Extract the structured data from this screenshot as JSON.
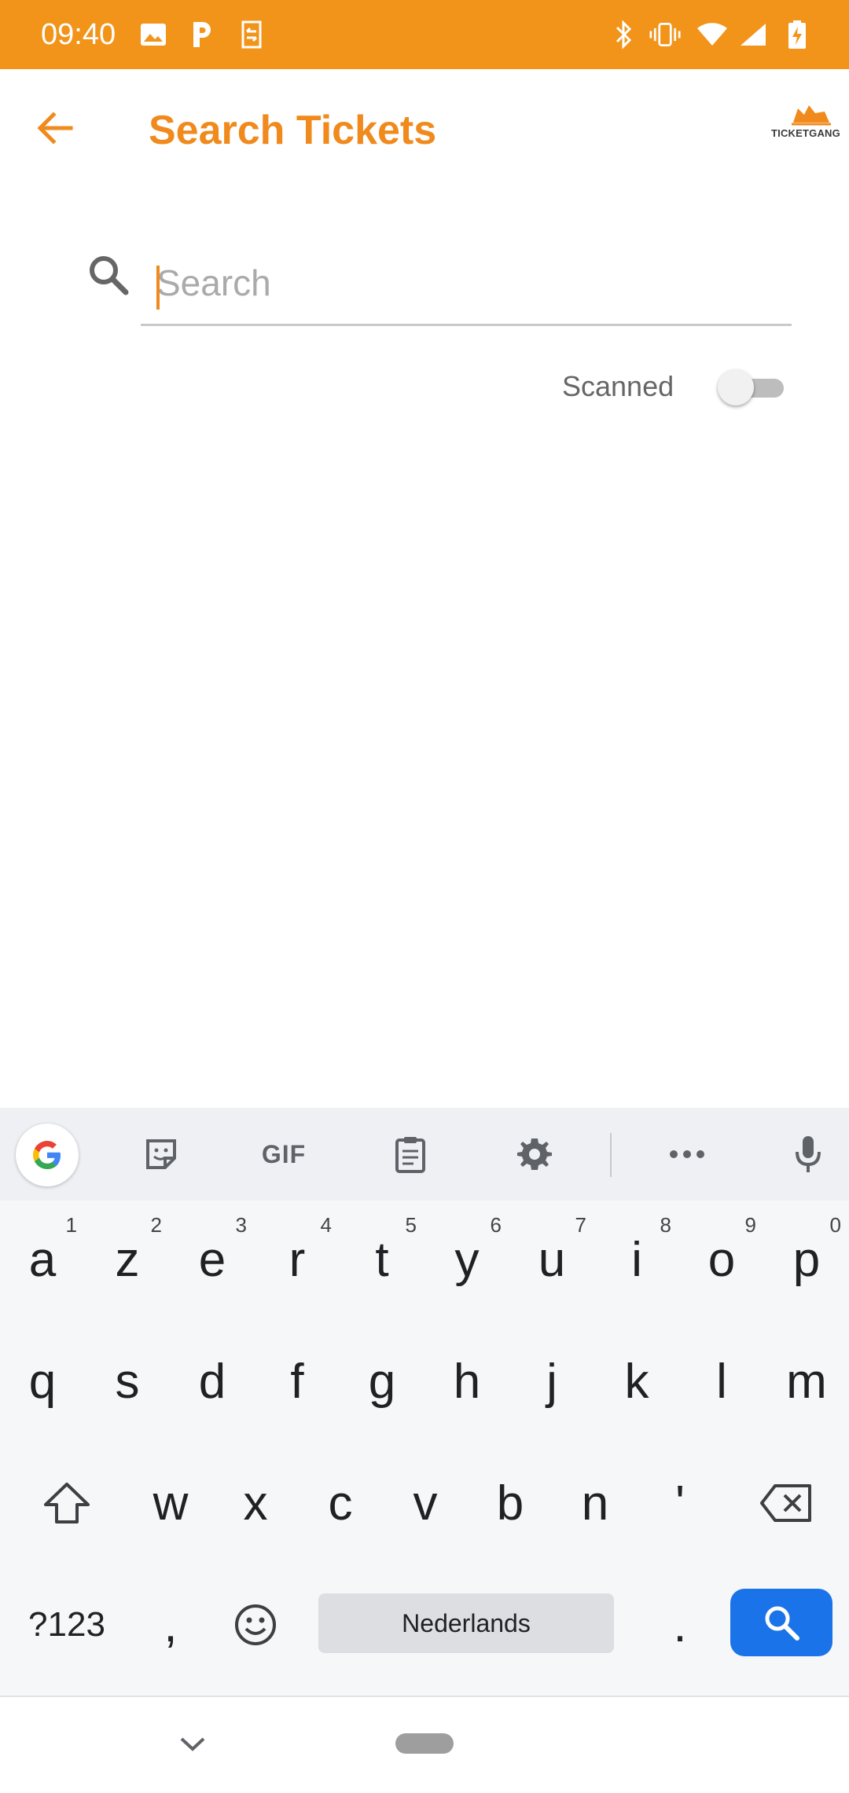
{
  "status_bar": {
    "time": "09:40",
    "left_icons": [
      "image-icon",
      "parking-icon",
      "nfc-tag-icon"
    ],
    "right_icons": [
      "bluetooth-icon",
      "vibrate-icon",
      "wifi-icon",
      "signal-icon",
      "battery-charging-icon"
    ],
    "background": "#F19419"
  },
  "app_bar": {
    "title": "Search Tickets",
    "back_icon": "arrow-left-icon",
    "logo_text": "TICKETGANG",
    "accent": "#F08A1C"
  },
  "search": {
    "placeholder": "Search",
    "value": ""
  },
  "filter": {
    "scanned_label": "Scanned",
    "scanned_on": false
  },
  "keyboard": {
    "language": "Nederlands",
    "toolbar": [
      "google-icon",
      "sticker-icon",
      "GIF",
      "clipboard-icon",
      "settings-icon",
      "more-icon",
      "mic-icon"
    ],
    "row1": [
      {
        "key": "a",
        "hint": "1"
      },
      {
        "key": "z",
        "hint": "2"
      },
      {
        "key": "e",
        "hint": "3"
      },
      {
        "key": "r",
        "hint": "4"
      },
      {
        "key": "t",
        "hint": "5"
      },
      {
        "key": "y",
        "hint": "6"
      },
      {
        "key": "u",
        "hint": "7"
      },
      {
        "key": "i",
        "hint": "8"
      },
      {
        "key": "o",
        "hint": "9"
      },
      {
        "key": "p",
        "hint": "0"
      }
    ],
    "row2": [
      "q",
      "s",
      "d",
      "f",
      "g",
      "h",
      "j",
      "k",
      "l",
      "m"
    ],
    "row3": [
      "w",
      "x",
      "c",
      "v",
      "b",
      "n",
      "'"
    ],
    "row4": {
      "symbols": "?123",
      "comma": ",",
      "period": "."
    },
    "enter_color": "#1A73E8"
  }
}
